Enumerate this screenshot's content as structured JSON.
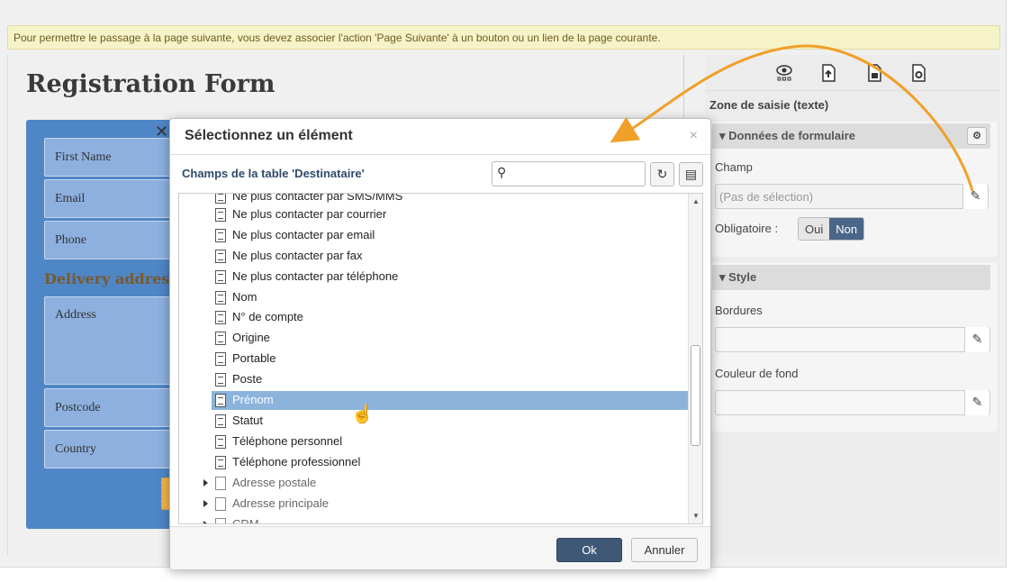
{
  "notice": "Pour permettre le passage à la page suivante, vous devez associer l'action 'Page Suivante' à un bouton ou un lien de la page courante.",
  "form": {
    "title": "Registration Form",
    "fields": [
      "First Name",
      "Email",
      "Phone"
    ],
    "section": "Delivery address",
    "fields2": [
      "Address",
      "Postcode",
      "Country"
    ]
  },
  "right_panel": {
    "title": "Zone de saisie (texte)",
    "section_data": "Données de formulaire",
    "champ_label": "Champ",
    "champ_placeholder": "(Pas de sélection)",
    "obligatoire_label": "Obligatoire :",
    "oui": "Oui",
    "non": "Non",
    "section_style": "Style",
    "bordures_label": "Bordures",
    "couleur_label": "Couleur de fond",
    "icons": [
      "eye-icon",
      "page-up-icon",
      "page-copy-icon",
      "page-settings-icon"
    ]
  },
  "dialog": {
    "title": "Sélectionnez un élément",
    "subtitle": "Champs de la table 'Destinataire'",
    "search_placeholder": "",
    "items": [
      "Ne plus contacter par SMS/MMS",
      "Ne plus contacter par courrier",
      "Ne plus contacter par email",
      "Ne plus contacter par fax",
      "Ne plus contacter par téléphone",
      "Nom",
      "N° de compte",
      "Origine",
      "Portable",
      "Poste",
      "Prénom",
      "Statut",
      "Téléphone personnel",
      "Téléphone professionnel"
    ],
    "selected": "Prénom",
    "nodes": [
      "Adresse postale",
      "Adresse principale",
      "CRM"
    ],
    "ok": "Ok",
    "cancel": "Annuler"
  },
  "colors": {
    "accent": "#3f5876",
    "selection": "#8cb3dc",
    "form_bg": "#4f86c6",
    "arrow": "#f0a028"
  }
}
